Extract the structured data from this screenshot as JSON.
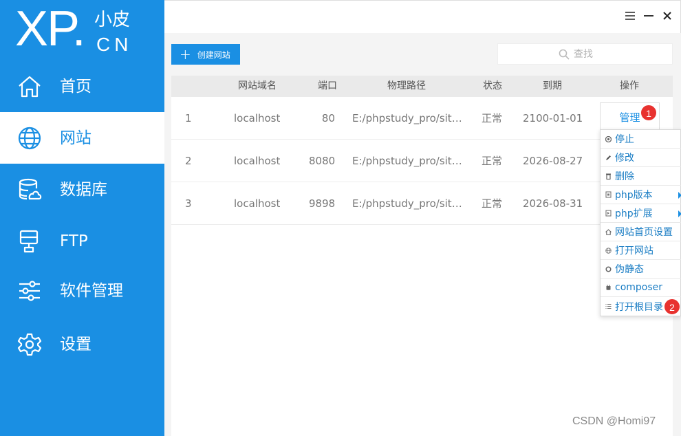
{
  "logo": {
    "main": "XP.",
    "sub_top": "小皮",
    "sub_bottom": "CN"
  },
  "sidebar": {
    "items": [
      {
        "label": "首页",
        "icon": "home-icon",
        "active": false
      },
      {
        "label": "网站",
        "icon": "globe-icon",
        "active": true
      },
      {
        "label": "数据库",
        "icon": "database-icon",
        "active": false
      },
      {
        "label": "FTP",
        "icon": "monitor-icon",
        "active": false
      },
      {
        "label": "软件管理",
        "icon": "sliders-icon",
        "active": false
      },
      {
        "label": "设置",
        "icon": "gear-icon",
        "active": false
      }
    ]
  },
  "window_controls": [
    "menu-icon",
    "minimize-icon",
    "close-icon"
  ],
  "toolbar": {
    "create_label": "创建网站",
    "search_placeholder": "查找"
  },
  "table": {
    "headers": [
      "网站域名",
      "端口",
      "物理路径",
      "状态",
      "到期",
      "操作"
    ],
    "rows": [
      {
        "index": "1",
        "domain": "localhost",
        "port": "80",
        "path": "E:/phpstudy_pro/sit…",
        "status": "正常",
        "expire": "2100-01-01"
      },
      {
        "index": "2",
        "domain": "localhost",
        "port": "8080",
        "path": "E:/phpstudy_pro/sit…",
        "status": "正常",
        "expire": "2026-08-27"
      },
      {
        "index": "3",
        "domain": "localhost",
        "port": "9898",
        "path": "E:/phpstudy_pro/sit…",
        "status": "正常",
        "expire": "2026-08-31"
      }
    ],
    "manage_label": "管理"
  },
  "badges": {
    "first": "1",
    "second": "2"
  },
  "dropdown": {
    "items": [
      {
        "label": "停止",
        "icon": "stop-icon",
        "submenu": false
      },
      {
        "label": "修改",
        "icon": "edit-icon",
        "submenu": false
      },
      {
        "label": "删除",
        "icon": "trash-icon",
        "submenu": false
      },
      {
        "label": "php版本",
        "icon": "php-version-icon",
        "submenu": true
      },
      {
        "label": "php扩展",
        "icon": "php-extension-icon",
        "submenu": true
      },
      {
        "label": "网站首页设置",
        "icon": "home-small-icon",
        "submenu": false
      },
      {
        "label": "打开网站",
        "icon": "globe-small-icon",
        "submenu": false
      },
      {
        "label": "伪静态",
        "icon": "rewrite-icon",
        "submenu": false
      },
      {
        "label": "composer",
        "icon": "composer-icon",
        "submenu": false
      },
      {
        "label": "打开根目录",
        "icon": "list-icon",
        "submenu": false
      }
    ]
  },
  "watermark": "CSDN @Homi97",
  "colors": {
    "primary": "#1a8fe3",
    "badge": "#e8322f",
    "link": "#1a7dc4"
  }
}
